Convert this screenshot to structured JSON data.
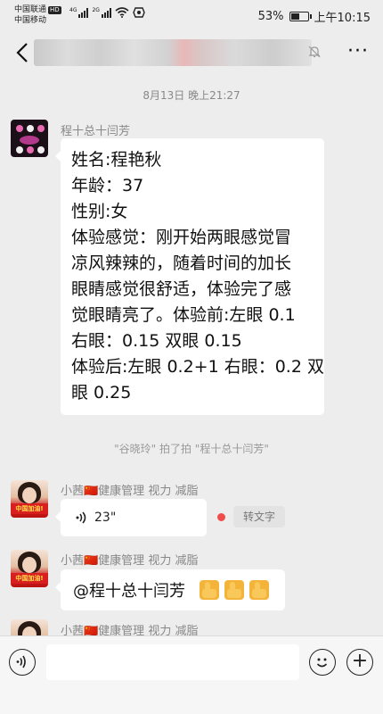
{
  "status_bar": {
    "carrier1": "中国联通",
    "hd_badge": "HD",
    "carrier2": "中国移动",
    "sig1_label": "4G",
    "sig2_label": "2G",
    "battery_pct": "53%",
    "battery_level": 0.53,
    "time": "上午10:15"
  },
  "header": {
    "back_icon": "chevron-left-icon",
    "mute_icon": "bell-off-icon",
    "more_icon": "more-dots-icon",
    "more_label": "···"
  },
  "timestamp": "8月13日 晚上21:27",
  "messages": [
    {
      "sender": "程十总十闫芳",
      "lines": [
        "姓名:程艳秋",
        "年龄：37",
        "性别:女",
        "体验感觉：刚开始两眼感觉冒",
        "凉风辣辣的，随着时间的加长",
        "眼睛感觉很舒适，体验完了感",
        "觉眼睛亮了。体验前:左眼 0.1",
        "右眼：0.15 双眼 0.15",
        "体验后:左眼 0.2+1 右眼：0.2 双",
        "眼 0.25"
      ]
    },
    {
      "sender": "小茜🇨🇳健康管理 视力 减脂",
      "voice_duration": "23\"",
      "to_text_label": "转文字"
    },
    {
      "sender": "小茜🇨🇳健康管理 视力 减脂",
      "text": "@程十总十闫芳",
      "emoji": [
        "thumbs-up",
        "thumbs-up",
        "thumbs-up"
      ]
    },
    {
      "sender": "小茜🇨🇳健康管理 视力 减脂"
    }
  ],
  "system_notice": "\"谷晓玲\" 拍了拍 \"程十总十闫芳\"",
  "avatar_banner": "中国加油!",
  "input_bar": {
    "voice_icon": "voice-mode-icon",
    "emoji_icon": "emoji-icon",
    "plus_icon": "plus-icon",
    "plus_label": "+"
  }
}
